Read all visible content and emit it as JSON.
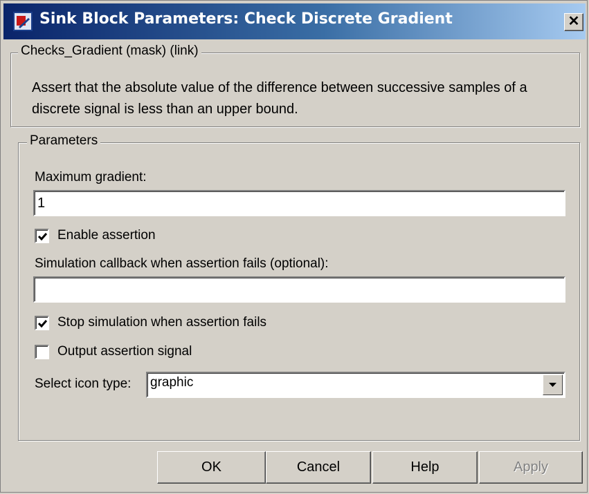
{
  "window": {
    "title": "Sink Block Parameters: Check Discrete Gradient",
    "close_label": "✕"
  },
  "mask_group": {
    "legend": "Checks_Gradient (mask) (link)",
    "description": "Assert that the absolute value of the difference between successive samples of a discrete signal is less than an upper bound."
  },
  "parameters": {
    "legend": "Parameters",
    "max_gradient_label": "Maximum gradient:",
    "max_gradient_value": "1",
    "enable_assertion_label": "Enable assertion",
    "enable_assertion_checked": true,
    "callback_label": "Simulation callback when assertion fails (optional):",
    "callback_value": "",
    "stop_simulation_label": "Stop simulation when assertion fails",
    "stop_simulation_checked": true,
    "output_signal_label": "Output assertion signal",
    "output_signal_checked": false,
    "icon_type_label": "Select icon type:",
    "icon_type_value": "graphic"
  },
  "buttons": {
    "ok": "OK",
    "cancel": "Cancel",
    "help": "Help",
    "apply": "Apply"
  },
  "colors": {
    "title_bar_start": "#0a246a",
    "title_bar_end": "#a6caf0",
    "dialog_bg": "#d4d0c8"
  }
}
